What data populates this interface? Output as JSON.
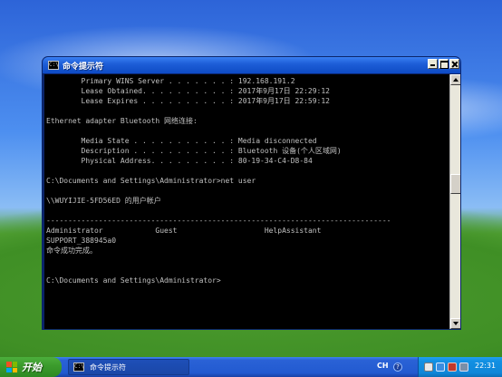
{
  "window": {
    "title": "命令提示符",
    "icon_text": "C:\\"
  },
  "console": {
    "lines": [
      "        Primary WINS Server . . . . . . . : 192.168.191.2",
      "        Lease Obtained. . . . . . . . . . : 2017年9月17日 22:29:12",
      "        Lease Expires . . . . . . . . . . : 2017年9月17日 22:59:12",
      "",
      "Ethernet adapter Bluetooth 网络连接:",
      "",
      "        Media State . . . . . . . . . . . : Media disconnected",
      "        Description . . . . . . . . . . . : Bluetooth 设备(个人区域网)",
      "        Physical Address. . . . . . . . . : 80-19-34-C4-D8-84",
      "",
      "C:\\Documents and Settings\\Administrator>net user",
      "",
      "\\\\WUYIJIE-5FD56ED 的用户帐户",
      "",
      "-------------------------------------------------------------------------------",
      "Administrator            Guest                    HelpAssistant",
      "SUPPORT_388945a0",
      "命令成功完成。",
      "",
      "",
      "C:\\Documents and Settings\\Administrator>"
    ]
  },
  "taskbar": {
    "start_label": "开始",
    "task_label": "命令提示符",
    "lang": "CH",
    "help_glyph": "?",
    "clock": "22:31"
  },
  "icons": {
    "start": "windows-logo-icon",
    "tray": [
      "network-icon",
      "volume-icon",
      "security-icon",
      "display-icon"
    ]
  }
}
